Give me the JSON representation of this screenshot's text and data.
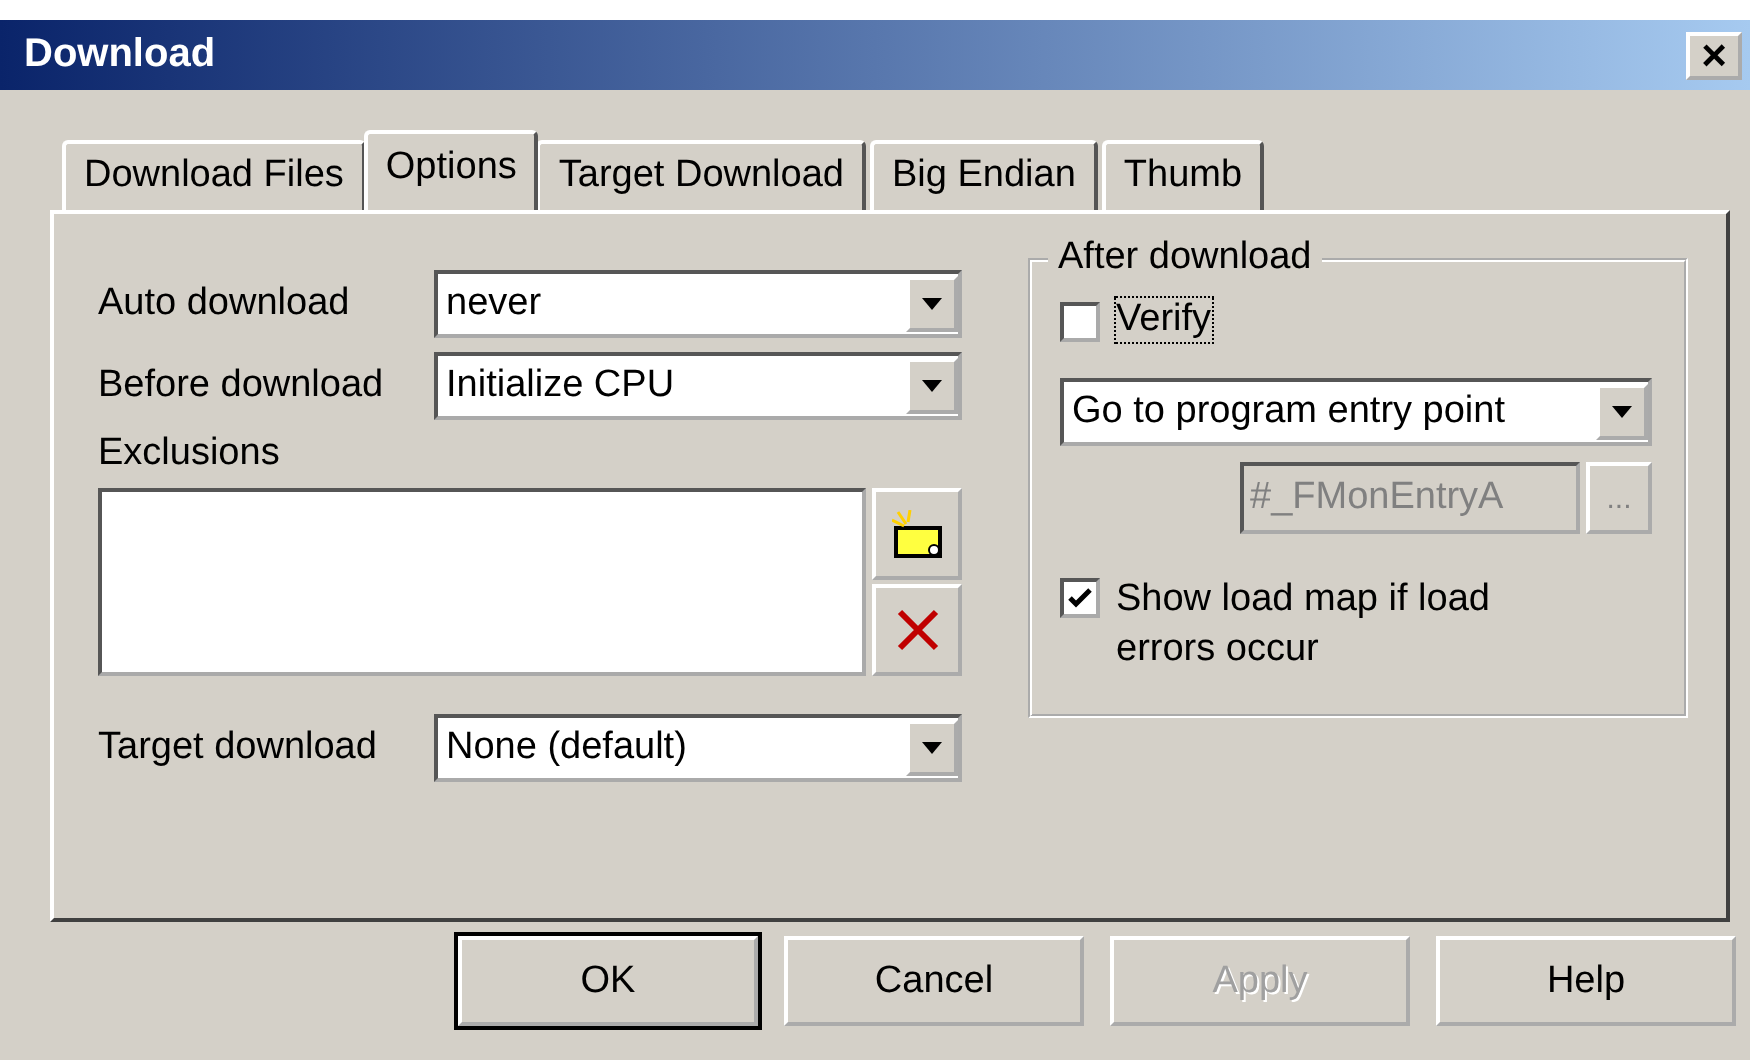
{
  "window": {
    "title": "Download",
    "close": "×"
  },
  "tabs": [
    {
      "label": "Download Files",
      "selected": false
    },
    {
      "label": "Options",
      "selected": true
    },
    {
      "label": "Target Download",
      "selected": false
    },
    {
      "label": "Big Endian",
      "selected": false
    },
    {
      "label": "Thumb",
      "selected": false
    }
  ],
  "fields": [
    {
      "label": "Auto download",
      "value": "never"
    },
    {
      "label": "Before download",
      "value": "Initialize CPU"
    }
  ],
  "exclusions": {
    "label": "Exclusions"
  },
  "target_download": {
    "label": "Target download",
    "value": "None (default)"
  },
  "after_download": {
    "title": "After download",
    "verify": {
      "label": "Verify",
      "checked": false,
      "focused": true
    },
    "action": {
      "value": "Go to program entry point"
    },
    "entry": {
      "value": "#_FMonEntryA",
      "disabled": true,
      "browse": "..."
    },
    "show_load_map": {
      "label": "Show load map if load errors occur",
      "checked": true
    }
  },
  "buttons": [
    {
      "label": "OK",
      "default": true,
      "disabled": false
    },
    {
      "label": "Cancel",
      "default": false,
      "disabled": false
    },
    {
      "label": "Apply",
      "default": false,
      "disabled": true
    },
    {
      "label": "Help",
      "default": false,
      "disabled": false
    }
  ]
}
